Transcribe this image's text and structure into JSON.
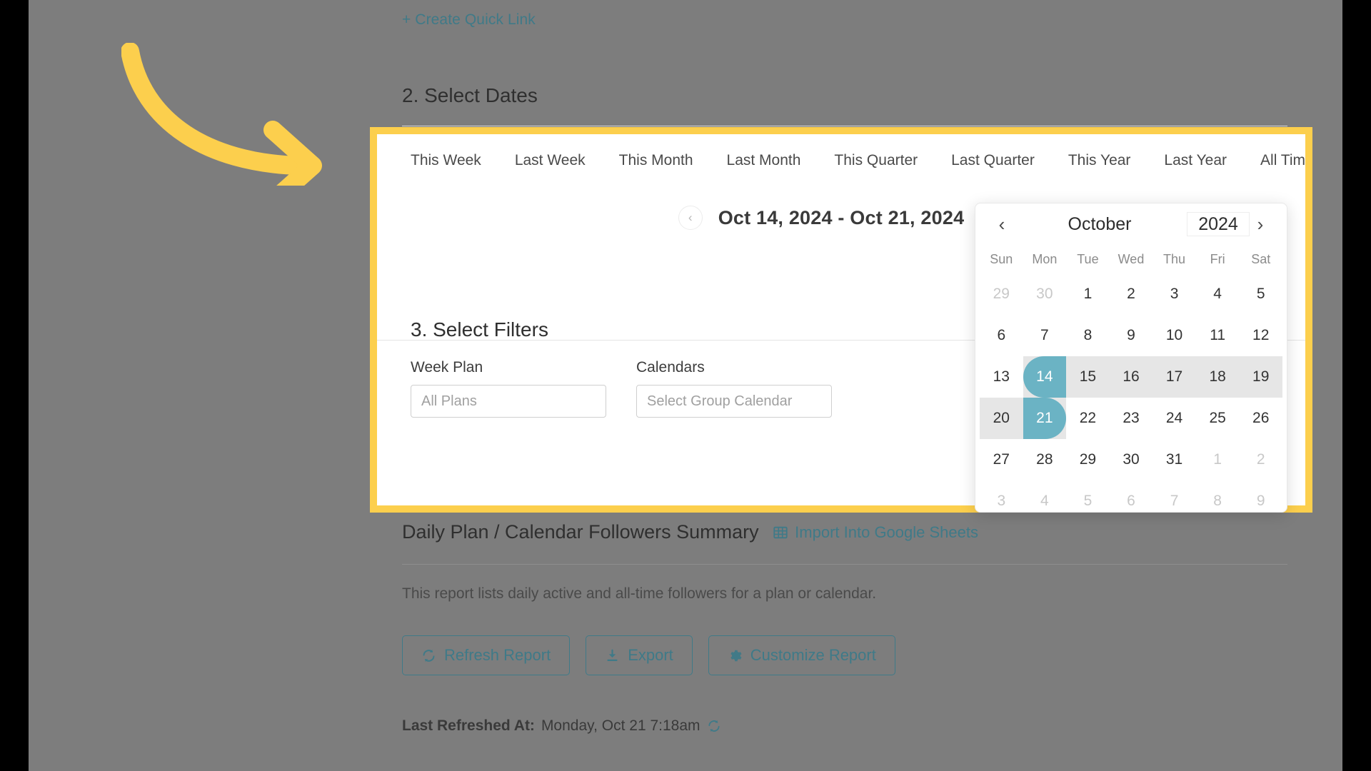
{
  "quick_link": {
    "label": "+ Create Quick Link"
  },
  "sections": {
    "dates": {
      "title": "2. Select Dates"
    },
    "filters": {
      "title": "3. Select Filters"
    }
  },
  "date_tabs": {
    "items": [
      {
        "label": "This Week"
      },
      {
        "label": "Last Week"
      },
      {
        "label": "This Month"
      },
      {
        "label": "Last Month"
      },
      {
        "label": "This Quarter"
      },
      {
        "label": "Last Quarter"
      },
      {
        "label": "This Year"
      },
      {
        "label": "Last Year"
      },
      {
        "label": "All Time"
      }
    ],
    "calendar_icon": "calendar-icon"
  },
  "date_nav": {
    "prev_icon": "chevron-left-icon",
    "next_icon": "chevron-right-icon",
    "range_label": "Oct 14, 2024 - Oct 21, 2024"
  },
  "filters": {
    "week_plan": {
      "label": "Week Plan",
      "value": "All Plans",
      "placeholder": "All Plans"
    },
    "calendars": {
      "label": "Calendars",
      "value": "Select Group Calendar",
      "placeholder": "Select Group Calendar"
    }
  },
  "datepicker": {
    "prev_icon": "chevron-left-icon",
    "next_icon": "chevron-right-icon",
    "month": "October",
    "year": "2024",
    "weekdays": [
      "Sun",
      "Mon",
      "Tue",
      "Wed",
      "Thu",
      "Fri",
      "Sat"
    ],
    "selection": {
      "start": "Oct 14, 2024",
      "end": "Oct 21, 2024"
    },
    "colors": {
      "selected": "#6bb3c4",
      "range": "#e6e6e6"
    },
    "weeks": [
      [
        {
          "d": "29",
          "state": "muted"
        },
        {
          "d": "30",
          "state": "muted"
        },
        {
          "d": "1",
          "state": "normal"
        },
        {
          "d": "2",
          "state": "normal"
        },
        {
          "d": "3",
          "state": "normal"
        },
        {
          "d": "4",
          "state": "normal"
        },
        {
          "d": "5",
          "state": "normal"
        }
      ],
      [
        {
          "d": "6",
          "state": "normal"
        },
        {
          "d": "7",
          "state": "normal"
        },
        {
          "d": "8",
          "state": "normal"
        },
        {
          "d": "9",
          "state": "normal"
        },
        {
          "d": "10",
          "state": "normal"
        },
        {
          "d": "11",
          "state": "normal"
        },
        {
          "d": "12",
          "state": "normal"
        }
      ],
      [
        {
          "d": "13",
          "state": "normal"
        },
        {
          "d": "14",
          "state": "selected-start"
        },
        {
          "d": "15",
          "state": "inrange"
        },
        {
          "d": "16",
          "state": "inrange"
        },
        {
          "d": "17",
          "state": "inrange"
        },
        {
          "d": "18",
          "state": "inrange"
        },
        {
          "d": "19",
          "state": "inrange"
        }
      ],
      [
        {
          "d": "20",
          "state": "inrange"
        },
        {
          "d": "21",
          "state": "selected-end"
        },
        {
          "d": "22",
          "state": "normal"
        },
        {
          "d": "23",
          "state": "normal"
        },
        {
          "d": "24",
          "state": "normal"
        },
        {
          "d": "25",
          "state": "normal"
        },
        {
          "d": "26",
          "state": "normal"
        }
      ],
      [
        {
          "d": "27",
          "state": "normal"
        },
        {
          "d": "28",
          "state": "normal"
        },
        {
          "d": "29",
          "state": "normal"
        },
        {
          "d": "30",
          "state": "normal"
        },
        {
          "d": "31",
          "state": "normal"
        },
        {
          "d": "1",
          "state": "muted"
        },
        {
          "d": "2",
          "state": "muted"
        }
      ],
      [
        {
          "d": "3",
          "state": "muted"
        },
        {
          "d": "4",
          "state": "muted"
        },
        {
          "d": "5",
          "state": "muted"
        },
        {
          "d": "6",
          "state": "muted"
        },
        {
          "d": "7",
          "state": "muted"
        },
        {
          "d": "8",
          "state": "muted"
        },
        {
          "d": "9",
          "state": "muted"
        }
      ]
    ]
  },
  "report": {
    "title": "Daily Plan / Calendar Followers Summary",
    "google_sheets_link": "Import Into Google Sheets",
    "google_sheets_icon": "table-grid-icon",
    "description": "This report lists daily active and all-time followers for a plan or calendar.",
    "buttons": [
      {
        "label": "Refresh Report",
        "icon": "refresh-icon"
      },
      {
        "label": "Export",
        "icon": "download-icon"
      },
      {
        "label": "Customize Report",
        "icon": "gear-icon"
      }
    ],
    "last_refreshed_label": "Last Refreshed At:",
    "last_refreshed_value": "Monday, Oct 21 7:18am",
    "last_refreshed_icon": "refresh-icon"
  },
  "annotation": {
    "arrow_color": "#fccf4d",
    "highlight_color": "#fccf4d"
  }
}
